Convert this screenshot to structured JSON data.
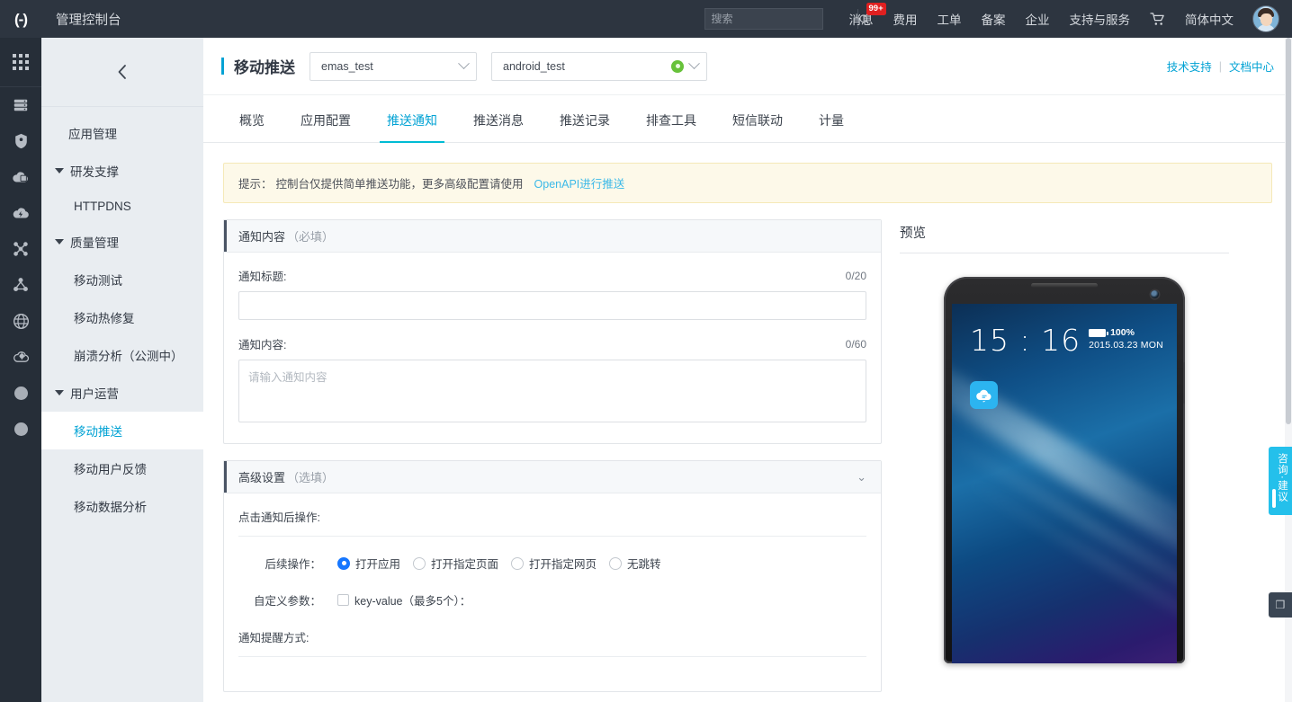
{
  "topbar": {
    "logo_icon": "aliyun-logo-icon",
    "console_title": "管理控制台",
    "search": {
      "placeholder": "搜索",
      "value": "",
      "icon": "search-icon"
    },
    "nav": [
      {
        "label": "消息",
        "badge": "99+"
      },
      {
        "label": "费用",
        "badge": ""
      },
      {
        "label": "工单",
        "badge": ""
      },
      {
        "label": "备案",
        "badge": ""
      },
      {
        "label": "企业",
        "badge": ""
      },
      {
        "label": "支持与服务",
        "badge": ""
      }
    ],
    "cart_icon": "shopping-cart-icon",
    "language": "简体中文",
    "avatar_icon": "user-avatar"
  },
  "rail": {
    "apps_icon": "app-grid-icon",
    "items": [
      {
        "icon": "server-stack-icon"
      },
      {
        "icon": "shield-icon"
      },
      {
        "icon": "cloud-storage-icon"
      },
      {
        "icon": "cloud-bolt-icon"
      },
      {
        "icon": "network-cross-icon"
      },
      {
        "icon": "share-nodes-icon"
      },
      {
        "icon": "globe-icon"
      },
      {
        "icon": "cloud-gear-icon"
      },
      {
        "icon": "circle-dot-icon"
      },
      {
        "icon": "circle-dot-icon"
      }
    ]
  },
  "menu": {
    "collapse_icon": "chevron-left-icon",
    "items": [
      {
        "label": "应用管理",
        "type": "leaf",
        "active": false
      },
      {
        "label": "研发支撑",
        "type": "group"
      },
      {
        "label": "HTTPDNS",
        "type": "child",
        "active": false
      },
      {
        "label": "质量管理",
        "type": "group"
      },
      {
        "label": "移动测试",
        "type": "child",
        "active": false
      },
      {
        "label": "移动热修复",
        "type": "child",
        "active": false
      },
      {
        "label": "崩溃分析（公测中）",
        "type": "child",
        "active": false
      },
      {
        "label": "用户运营",
        "type": "group"
      },
      {
        "label": "移动推送",
        "type": "child",
        "active": true
      },
      {
        "label": "移动用户反馈",
        "type": "child",
        "active": false
      },
      {
        "label": "移动数据分析",
        "type": "child",
        "active": false
      }
    ]
  },
  "page": {
    "title": "移动推送",
    "project_select": {
      "value": "emas_test",
      "icon": "chevron-down-icon"
    },
    "app_select": {
      "value": "android_test",
      "status_icon": "green-status-dot",
      "icon": "chevron-down-icon"
    },
    "links": [
      {
        "label": "技术支持"
      },
      {
        "label": "文档中心"
      }
    ],
    "link_separator": "|"
  },
  "tabs": [
    {
      "label": "概览",
      "active": false
    },
    {
      "label": "应用配置",
      "active": false
    },
    {
      "label": "推送通知",
      "active": true
    },
    {
      "label": "推送消息",
      "active": false
    },
    {
      "label": "推送记录",
      "active": false
    },
    {
      "label": "排查工具",
      "active": false
    },
    {
      "label": "短信联动",
      "active": false
    },
    {
      "label": "计量",
      "active": false
    }
  ],
  "notice": {
    "prefix": "提示：",
    "text": "控制台仅提供简单推送功能，更多高级配置请使用",
    "link": "OpenAPI进行推送"
  },
  "notification_card": {
    "title": "通知内容",
    "subtitle": "（必填）",
    "accent_color": "#4a5464",
    "title_field": {
      "label": "通知标题:",
      "counter": "0/20",
      "value": "",
      "placeholder": ""
    },
    "content_field": {
      "label": "通知内容:",
      "counter": "0/60",
      "value": "",
      "placeholder": "请输入通知内容"
    }
  },
  "advanced_card": {
    "title": "高级设置",
    "subtitle": "（选填）",
    "toggle_icon": "chevron-down-icon",
    "section_click_label": "点击通知后操作:",
    "action_row": {
      "label": "后续操作：",
      "options": [
        {
          "label": "打开应用",
          "checked": true
        },
        {
          "label": "打开指定页面",
          "checked": false
        },
        {
          "label": "打开指定网页",
          "checked": false
        },
        {
          "label": "无跳转",
          "checked": false
        }
      ]
    },
    "custom_param_row": {
      "label": "自定义参数：",
      "checkbox_label": "key-value（最多5个）：",
      "checked": false
    },
    "section_remind_label": "通知提醒方式:"
  },
  "preview": {
    "title": "预览",
    "phone": {
      "time": "15 : 16",
      "battery": "100%",
      "date": "2015.03.23 MON",
      "app_icon": "cloud-chat-icon"
    }
  },
  "floating": {
    "consult": {
      "icon": "chat-bubble-icon",
      "text": "咨询·建议"
    },
    "back_to_top": {
      "icon": "collapse-arrows-icon"
    }
  },
  "colors": {
    "accent": "#00a2d4",
    "tab_active": "#00bcd4",
    "topbar_bg": "#2d3540",
    "rail_bg": "#262e38",
    "menu_bg": "#e9edf1",
    "notice_bg": "#fdf9e9",
    "radio_on": "#1677ff",
    "status_green": "#67c23a",
    "badge_red": "#e02020",
    "consult_cyan": "#24c0eb"
  }
}
